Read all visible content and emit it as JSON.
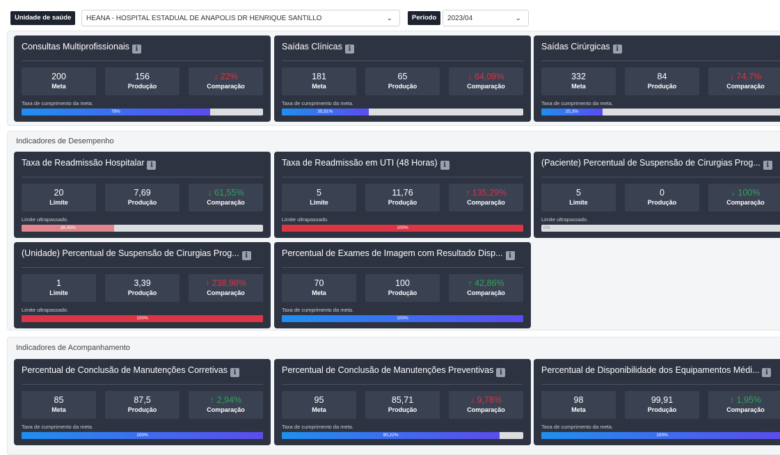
{
  "filters": {
    "unit_label": "Unidade de saúde",
    "unit_value": "HEANA - HOSPITAL ESTADUAL DE ANAPOLIS DR HENRIQUE SANTILLO",
    "period_label": "Período",
    "period_value": "2023/04"
  },
  "sections": {
    "desempenho": "Indicadores de Desempenho",
    "acompanhamento": "Indicadores de Acompanhamento"
  },
  "labels": {
    "meta": "Meta",
    "limite": "Limite",
    "producao": "Produção",
    "comparacao": "Comparação",
    "info": "i"
  },
  "colors": {
    "card_bg": "#2d3341",
    "negative": "#dd3244",
    "positive": "#2fa55a",
    "bar_blue": "#1f8ff0",
    "bar_red": "#dc3545"
  },
  "cards": [
    {
      "title": "Consultas Multiprofissionais",
      "target": "200",
      "target_label": "Meta",
      "production": "156",
      "comparison": "↓ 22%",
      "trend": "neg",
      "caption": "Taxa de cumprimento da meta.",
      "progress_text": "78%",
      "progress": 78
    },
    {
      "title": "Saídas Clínicas",
      "target": "181",
      "target_label": "Meta",
      "production": "65",
      "comparison": "↓ 64,09%",
      "trend": "neg",
      "caption": "Taxa de cumprimento da meta.",
      "progress_text": "35,91%",
      "progress": 35.91
    },
    {
      "title": "Saídas Cirúrgicas",
      "target": "332",
      "target_label": "Meta",
      "production": "84",
      "comparison": "↓ 74,7%",
      "trend": "neg",
      "caption": "Taxa de cumprimento da meta.",
      "progress_text": "25,3%",
      "progress": 25.3
    },
    {
      "title": "Taxa de Readmissão Hospitalar",
      "target": "20",
      "target_label": "Limite",
      "production": "7,69",
      "comparison": "↓ 61,55%",
      "trend": "pos",
      "caption": "Limite ultrapassado.",
      "progress_text": "38,45%",
      "progress": 38.45
    },
    {
      "title": "Taxa de Readmissão em UTI (48 Horas)",
      "target": "5",
      "target_label": "Limite",
      "production": "11,76",
      "comparison": "↑ 135,29%",
      "trend": "neg",
      "caption": "Limite ultrapassado.",
      "progress_text": "100%",
      "progress": 100
    },
    {
      "title": "(Paciente) Percentual de Suspensão de Cirurgias Prog...",
      "target": "5",
      "target_label": "Limite",
      "production": "0",
      "comparison": "↓ 100%",
      "trend": "pos",
      "caption": "Limite ultrapassado.",
      "progress_text": "0%",
      "progress": 0
    },
    {
      "title": "(Unidade) Percentual de Suspensão de Cirurgias Prog...",
      "target": "1",
      "target_label": "Limite",
      "production": "3,39",
      "comparison": "↑ 238,98%",
      "trend": "neg",
      "caption": "Limite ultrapassado.",
      "progress_text": "100%",
      "progress": 100
    },
    {
      "title": "Percentual de Exames de Imagem com Resultado Disp...",
      "target": "70",
      "target_label": "Meta",
      "production": "100",
      "comparison": "↑ 42,86%",
      "trend": "pos",
      "caption": "Taxa de cumprimento da meta.",
      "progress_text": "100%",
      "progress": 100
    },
    {
      "title": "Percentual de Conclusão de Manutenções Corretivas",
      "target": "85",
      "target_label": "Meta",
      "production": "87,5",
      "comparison": "↑ 2,94%",
      "trend": "pos",
      "caption": "Taxa de cumprimento da meta.",
      "progress_text": "100%",
      "progress": 100
    },
    {
      "title": "Percentual de Conclusão de Manutenções Preventivas",
      "target": "95",
      "target_label": "Meta",
      "production": "85,71",
      "comparison": "↓ 9,78%",
      "trend": "neg",
      "caption": "Taxa de cumprimento da meta.",
      "progress_text": "90,22%",
      "progress": 90.22
    },
    {
      "title": "Percentual de Disponibilidade dos Equipamentos Médi...",
      "target": "98",
      "target_label": "Meta",
      "production": "99,91",
      "comparison": "↑ 1,95%",
      "trend": "pos",
      "caption": "Taxa de cumprimento da meta.",
      "progress_text": "100%",
      "progress": 100
    }
  ]
}
